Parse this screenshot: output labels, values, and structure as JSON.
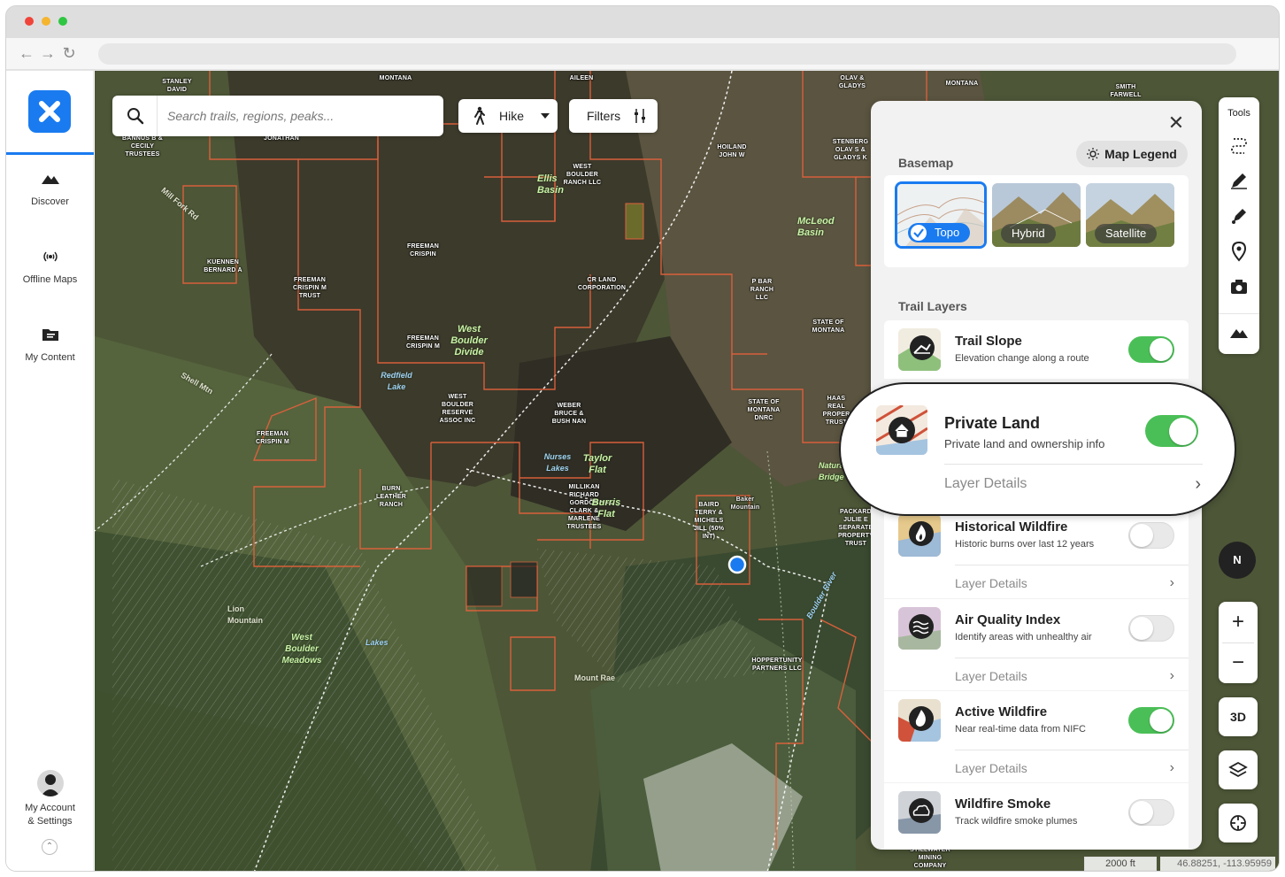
{
  "sidebar": {
    "items": [
      {
        "label": "Discover",
        "icon": "discover-icon"
      },
      {
        "label": "Offline Maps",
        "icon": "offline-maps-icon"
      },
      {
        "label": "My Content",
        "icon": "my-content-icon"
      }
    ],
    "account_label_line1": "My Account",
    "account_label_line2": "& Settings"
  },
  "search": {
    "placeholder": "Search trails, regions, peaks..."
  },
  "activity": {
    "label": "Hike"
  },
  "filters": {
    "label": "Filters"
  },
  "tools": {
    "label": "Tools",
    "icons": [
      "route-icon",
      "pencil-icon",
      "edit-pencil-icon",
      "location-pin-icon",
      "camera-icon",
      "terrain-icon"
    ]
  },
  "map_controls": {
    "compass_label": "N",
    "zoom_in": "+",
    "zoom_out": "−",
    "view_3d": "3D"
  },
  "panel": {
    "basemap_title": "Basemap",
    "legend_label": "Map Legend",
    "basemaps": [
      {
        "label": "Topo",
        "selected": true
      },
      {
        "label": "Hybrid",
        "selected": false
      },
      {
        "label": "Satellite",
        "selected": false
      }
    ],
    "trail_layers_title": "Trail Layers",
    "layers": [
      {
        "name": "Trail Slope",
        "desc": "Elevation change along a route",
        "on": true
      },
      {
        "name": "Private Land",
        "desc": "Private land and ownership info",
        "on": true,
        "details": "Layer Details"
      },
      {
        "name": "Historical Wildfire",
        "desc": "Historic burns over last 12 years",
        "on": false,
        "details": "Layer Details"
      },
      {
        "name": "Air Quality Index",
        "desc": "Identify areas with unhealthy air",
        "on": false,
        "details": "Layer Details"
      },
      {
        "name": "Active Wildfire",
        "desc": "Near real-time data from NIFC",
        "on": true,
        "details": "Layer Details"
      },
      {
        "name": "Wildfire Smoke",
        "desc": "Track wildfire smoke plumes",
        "on": false
      }
    ]
  },
  "map_labels": {
    "stanley_david": "STANLEY DAVID",
    "montana_1": "MONTANA",
    "aileen": "AILEEN",
    "olav_gladys": "OLAV & GLADYS",
    "montana_2": "MONTANA",
    "smith_farwell": "SMITH FARWELL",
    "bannus": "BANNUS B & CECILY TRUSTEES",
    "jonathan": "JONATHAN",
    "hoiland": "HOILAND JOHN W",
    "stenberg": "STENBERG OLAV S & GLADYS K",
    "west_boulder_ranch": "WEST BOULDER RANCH LLC",
    "ellis_basin": "Ellis Basin",
    "mcleod_basin": "McLeod Basin",
    "kuennen": "KUENNEN BERNARD A",
    "freeman_crispin_1": "FREEMAN CRISPIN",
    "freeman_crispin_trust": "FREEMAN CRISPIN M TRUST",
    "cr_land": "CR LAND CORPORATION",
    "p_bar_ranch": "P BAR RANCH LLC",
    "state_montana_1": "STATE OF MONTANA",
    "freeman_crispin_m": "FREEMAN CRISPIN M",
    "west_boulder_divide": "West Boulder Divide",
    "redfield_lake": "Redfield Lake",
    "west_boulder_reserve": "WEST BOULDER RESERVE ASSOC INC",
    "weber_bruce": "WEBER BRUCE & BUSH NAN",
    "state_montana_dnrc": "STATE OF MONTANA DNRC",
    "haas_real": "HAAS REAL PROPER TRUST",
    "freeman_crispin_m2": "FREEMAN CRISPIN M",
    "taylor_flat": "Taylor Flat",
    "nurses_lakes": "Nurses Lakes",
    "burn_leather": "BURN LEATHER RANCH",
    "millikan": "MILLIKAN RICHARD GORDON CLARK & MARLENE TRUSTEES",
    "burris_flat": "Burris Flat",
    "baird_terry": "BAIRD TERRY & MICHELS JILL (50% INT)",
    "baker_mountain": "Baker Mountain",
    "packard": "PACKARD JULIE E SEPARATE PROPERTY TRUST",
    "lion_mountain": "Lion Mountain",
    "west_boulder_meadows": "West Boulder Meadows",
    "hoppertunity": "HOPPERTUNITY PARTNERS LLC",
    "mount_rae": "Mount Rae",
    "stillwater": "STILLWATER MINING COMPANY",
    "twin_lakes": "Lakes",
    "boulder_river": "Boulder River",
    "natural_bridge": "Natural Bridge",
    "shell_mtn": "Shell Mtn",
    "mill_fork": "Mill Fork Rd"
  },
  "scale_bar": {
    "label": "2000 ft"
  },
  "coordinates": {
    "text": "46.88251, -113.95959"
  },
  "colors": {
    "accent": "#1a7bf0",
    "toggle_on": "#4bbf57",
    "parcel_line": "#e0613c"
  }
}
